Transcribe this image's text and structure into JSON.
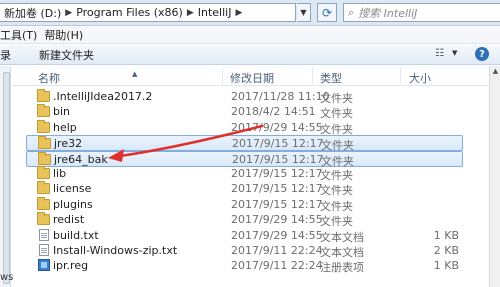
{
  "address": {
    "crumbs": [
      "新加卷 (D:)",
      "Program Files (x86)",
      "IntelliJ"
    ],
    "search_placeholder": "搜索 IntelliJ"
  },
  "menu": {
    "items": [
      "工具(T)",
      "帮助(H)"
    ]
  },
  "toolbar": {
    "first_label": "录",
    "new_folder_label": "新建文件夹"
  },
  "columns": {
    "name": "名称",
    "date": "修改日期",
    "type": "类型",
    "size": "大小"
  },
  "files": [
    {
      "name": ".IntelliJIdea2017.2",
      "date": "2017/11/28 11:10",
      "type": "文件夹",
      "size": "",
      "icon": "folder-icon",
      "selected": false
    },
    {
      "name": "bin",
      "date": "2018/4/2 14:51",
      "type": "文件夹",
      "size": "",
      "icon": "folder-icon",
      "selected": false
    },
    {
      "name": "help",
      "date": "2017/9/29 14:55",
      "type": "文件夹",
      "size": "",
      "icon": "folder-icon",
      "selected": false
    },
    {
      "name": "jre32",
      "date": "2017/9/15 12:17",
      "type": "文件夹",
      "size": "",
      "icon": "folder-icon",
      "selected": true
    },
    {
      "name": "jre64_bak",
      "date": "2017/9/15 12:17",
      "type": "文件夹",
      "size": "",
      "icon": "folder-icon",
      "selected": true
    },
    {
      "name": "lib",
      "date": "2017/9/15 12:17",
      "type": "文件夹",
      "size": "",
      "icon": "folder-icon",
      "selected": false
    },
    {
      "name": "license",
      "date": "2017/9/15 12:17",
      "type": "文件夹",
      "size": "",
      "icon": "folder-icon",
      "selected": false
    },
    {
      "name": "plugins",
      "date": "2017/9/15 12:17",
      "type": "文件夹",
      "size": "",
      "icon": "folder-icon",
      "selected": false
    },
    {
      "name": "redist",
      "date": "2017/9/29 14:55",
      "type": "文件夹",
      "size": "",
      "icon": "folder-icon",
      "selected": false
    },
    {
      "name": "build.txt",
      "date": "2017/9/29 14:55",
      "type": "文本文档",
      "size": "1 KB",
      "icon": "text-file-icon",
      "selected": false
    },
    {
      "name": "Install-Windows-zip.txt",
      "date": "2017/9/11 22:24",
      "type": "文本文档",
      "size": "2 KB",
      "icon": "text-file-icon",
      "selected": false
    },
    {
      "name": "ipr.reg",
      "date": "2017/9/11 22:24",
      "type": "注册表项",
      "size": "1 KB",
      "icon": "registry-file-icon",
      "selected": false
    }
  ],
  "nav_fragment": "ws",
  "colors": {
    "selection_border": "#84acdd",
    "annotation_arrow": "#e0302b"
  }
}
